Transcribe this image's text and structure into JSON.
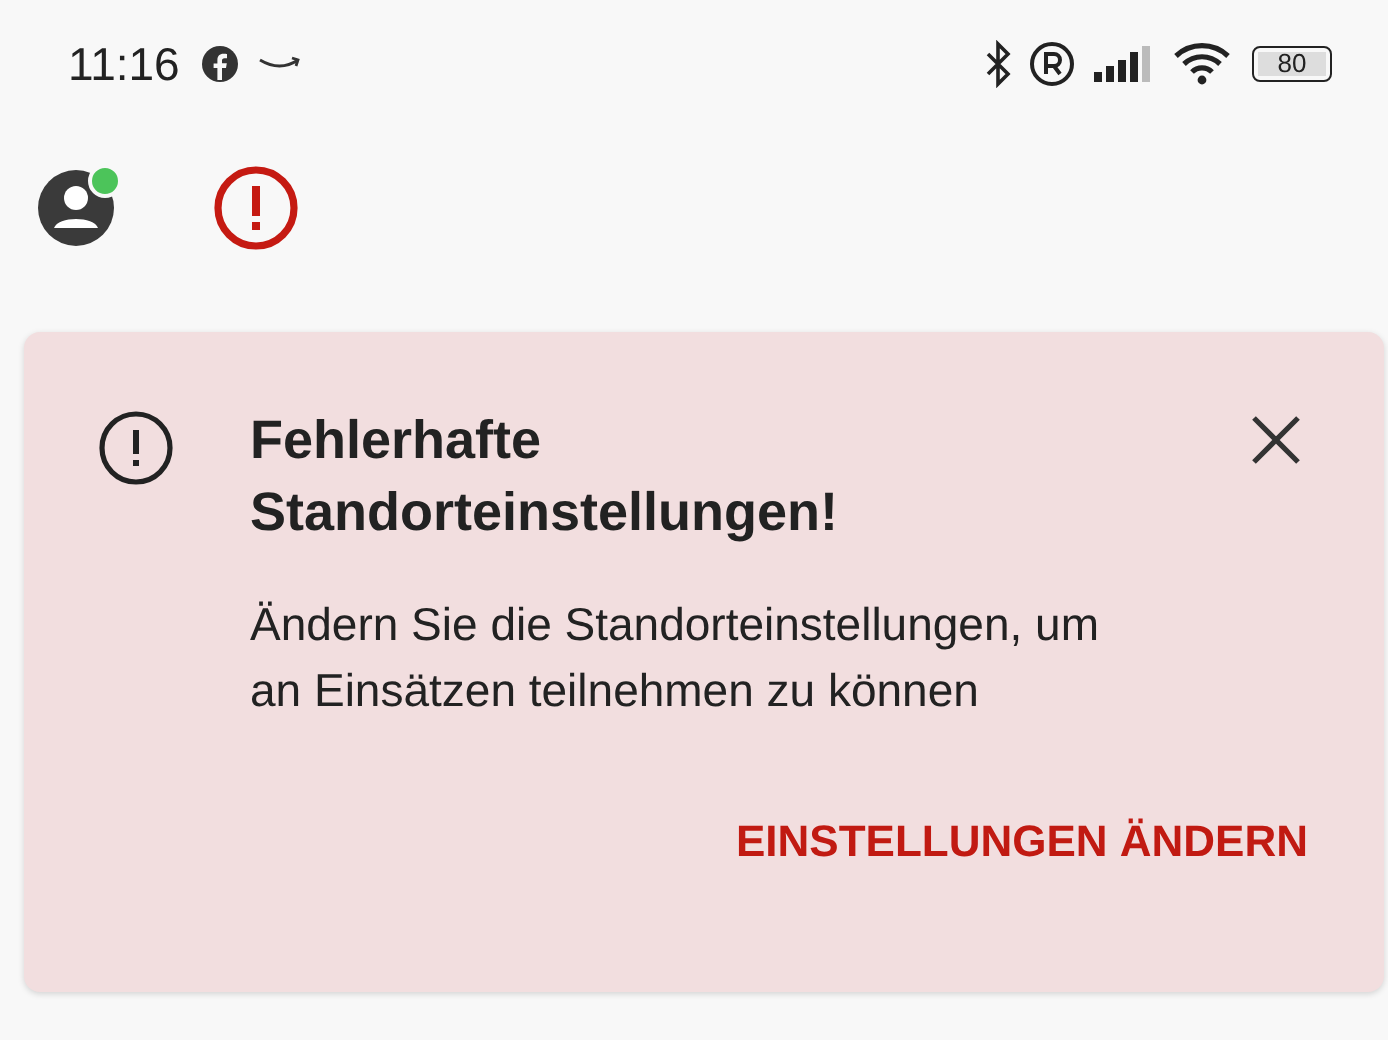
{
  "status_bar": {
    "time": "11:16",
    "battery": "80"
  },
  "top_bar": {
    "avatar_online": true
  },
  "alert": {
    "title": "Fehlerhafte Standorteinstellungen!",
    "message": "Ändern Sie die Standorteinstellungen, um an Einsätzen teilnehmen zu können",
    "action": "EINSTELLUNGEN ÄNDERN"
  }
}
